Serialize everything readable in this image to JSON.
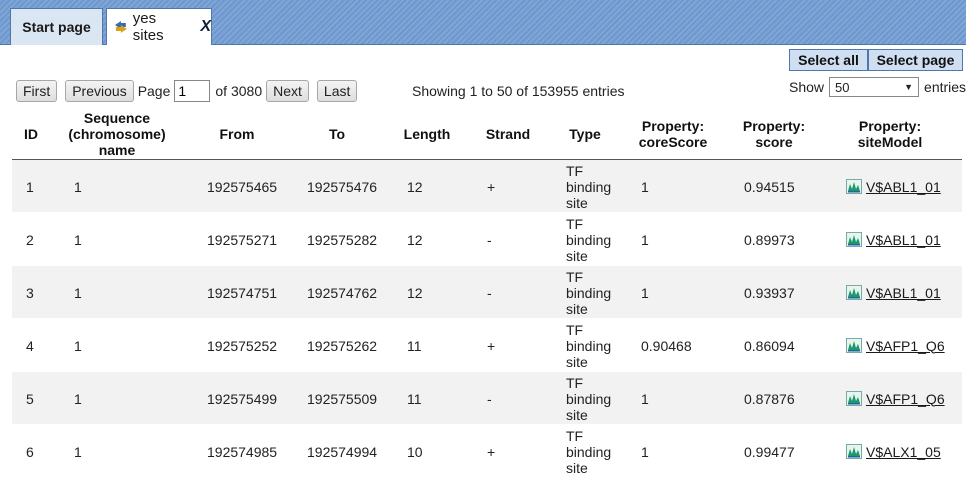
{
  "tabs": [
    {
      "label": "Start page"
    },
    {
      "label": "yes sites",
      "close": "X"
    }
  ],
  "selection": {
    "select_all": "Select all",
    "select_page": "Select page"
  },
  "pager": {
    "first": "First",
    "previous": "Previous",
    "page_label": "Page",
    "page_value": "1",
    "of_label": "of 3080",
    "next": "Next",
    "last": "Last",
    "showing": "Showing 1 to 50 of 153955 entries",
    "show_label": "Show",
    "show_value": "50",
    "entries_label": "entries"
  },
  "columns": [
    "ID",
    "Sequence (chromosome) name",
    "From",
    "To",
    "Length",
    "Strand",
    "Type",
    "Property: coreScore",
    "Property: score",
    "Property: siteModel"
  ],
  "rows": [
    {
      "id": "1",
      "seq": "1",
      "from": "192575465",
      "to": "192575476",
      "length": "12",
      "strand": "+",
      "type": "TF binding site",
      "core": "1",
      "score": "0.94515",
      "model": "V$ABL1_01"
    },
    {
      "id": "2",
      "seq": "1",
      "from": "192575271",
      "to": "192575282",
      "length": "12",
      "strand": "-",
      "type": "TF binding site",
      "core": "1",
      "score": "0.89973",
      "model": "V$ABL1_01"
    },
    {
      "id": "3",
      "seq": "1",
      "from": "192574751",
      "to": "192574762",
      "length": "12",
      "strand": "-",
      "type": "TF binding site",
      "core": "1",
      "score": "0.93937",
      "model": "V$ABL1_01"
    },
    {
      "id": "4",
      "seq": "1",
      "from": "192575252",
      "to": "192575262",
      "length": "11",
      "strand": "+",
      "type": "TF binding site",
      "core": "0.90468",
      "score": "0.86094",
      "model": "V$AFP1_Q6"
    },
    {
      "id": "5",
      "seq": "1",
      "from": "192575499",
      "to": "192575509",
      "length": "11",
      "strand": "-",
      "type": "TF binding site",
      "core": "1",
      "score": "0.87876",
      "model": "V$AFP1_Q6"
    },
    {
      "id": "6",
      "seq": "1",
      "from": "192574985",
      "to": "192574994",
      "length": "10",
      "strand": "+",
      "type": "TF binding site",
      "core": "1",
      "score": "0.99477",
      "model": "V$ALX1_05"
    }
  ],
  "icons": {
    "tab_icon": "arrows-icon",
    "model_icon": "site-model-icon"
  },
  "colors": {
    "tabbar": "#7fa6d6",
    "tab_border": "#4d77ad",
    "row_stripe": "#f2f2f2",
    "select_btn": "#cfdff1"
  }
}
